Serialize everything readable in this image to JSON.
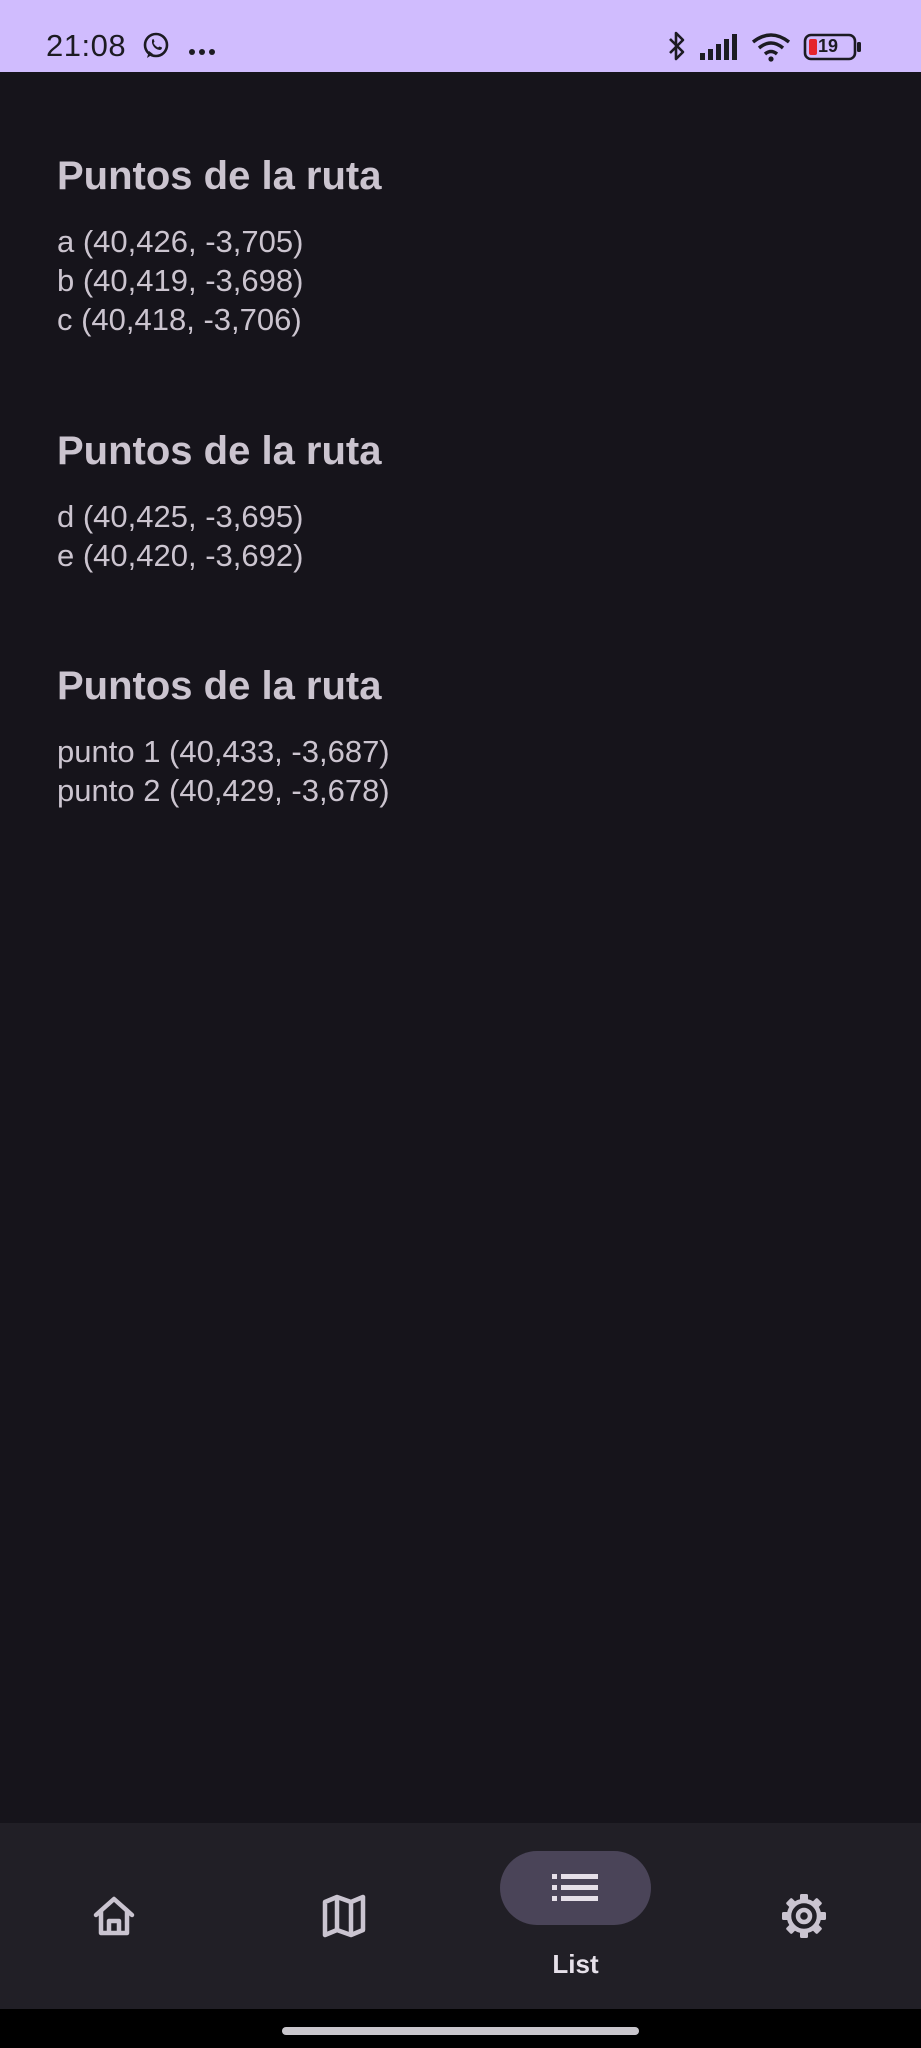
{
  "status_bar": {
    "time": "21:08",
    "notification_icons": [
      "whatsapp-icon",
      "more-dots-icon"
    ],
    "system_icons": [
      "bluetooth-icon",
      "signal-icon",
      "wifi-icon",
      "battery-icon"
    ],
    "battery_level": "19",
    "background_color": "#d0bcfe"
  },
  "routes": [
    {
      "title": "Puntos de la ruta",
      "points": [
        "a (40,426, -3,705)",
        "b (40,419, -3,698)",
        "c (40,418, -3,706)"
      ]
    },
    {
      "title": "Puntos de la ruta",
      "points": [
        "d (40,425, -3,695)",
        "e (40,420, -3,692)"
      ]
    },
    {
      "title": "Puntos de la ruta",
      "points": [
        "punto 1 (40,433, -3,687)",
        "punto 2 (40,429, -3,678)"
      ]
    }
  ],
  "bottom_nav": {
    "items": [
      {
        "icon": "home-icon",
        "label": "",
        "selected": false
      },
      {
        "icon": "map-icon",
        "label": "",
        "selected": false
      },
      {
        "icon": "list-icon",
        "label": "List",
        "selected": true
      },
      {
        "icon": "settings-icon",
        "label": "",
        "selected": false
      }
    ],
    "selected_indicator_color": "#4a4458"
  },
  "colors": {
    "background": "#16141b",
    "text": "#cbc4cf",
    "nav_background": "#211f26"
  }
}
